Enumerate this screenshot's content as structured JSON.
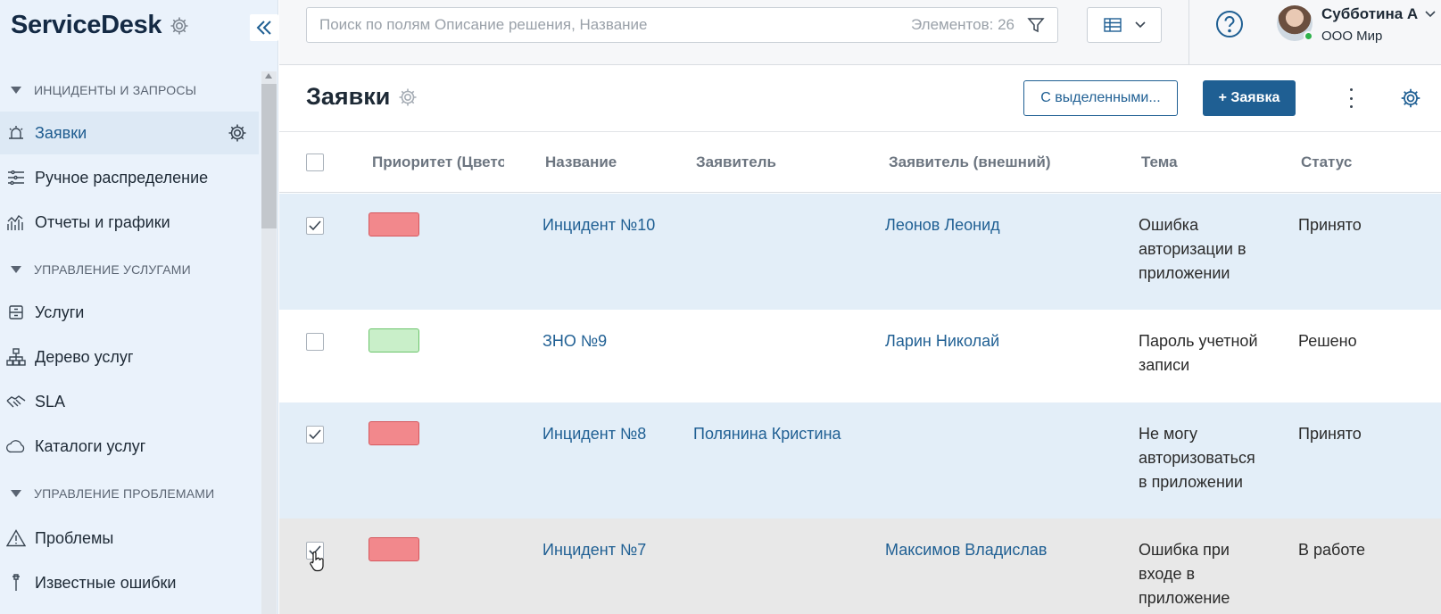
{
  "app": {
    "logo": "ServiceDesk"
  },
  "sidebar": {
    "sections": [
      {
        "title": "ИНЦИДЕНТЫ И ЗАПРОСЫ"
      },
      {
        "title": "УПРАВЛЕНИЕ УСЛУГАМИ"
      },
      {
        "title": "УПРАВЛЕНИЕ ПРОБЛЕМАМИ"
      }
    ],
    "items": [
      {
        "label": "Заявки",
        "icon": "requests-icon"
      },
      {
        "label": "Ручное распределение",
        "icon": "distribution-icon"
      },
      {
        "label": "Отчеты и графики",
        "icon": "chart-icon"
      },
      {
        "label": "Услуги",
        "icon": "services-icon"
      },
      {
        "label": "Дерево услуг",
        "icon": "tree-icon"
      },
      {
        "label": "SLA",
        "icon": "handshake-icon"
      },
      {
        "label": "Каталоги услуг",
        "icon": "cloud-icon"
      },
      {
        "label": "Проблемы",
        "icon": "warning-icon"
      },
      {
        "label": "Известные ошибки",
        "icon": "tool-icon"
      }
    ]
  },
  "topbar": {
    "search_placeholder": "Поиск по полям Описание решения, Название",
    "element_count": "Элементов: 26",
    "user_name": "Субботина А",
    "user_org": "ООО Мир"
  },
  "header": {
    "title": "Заявки",
    "selected_button": "С выделенными...",
    "new_button": "+ Заявка"
  },
  "table": {
    "columns": [
      "Приоритет (Цвето",
      "Название",
      "Заявитель",
      "Заявитель (внешний)",
      "Тема",
      "Статус"
    ],
    "rows": [
      {
        "checked": true,
        "priority": "high",
        "name": "Инцидент №10",
        "applicant": "",
        "external": "Леонов Леонид",
        "topic": [
          "Ошибка",
          "авторизации в",
          "приложении"
        ],
        "status": "Принято"
      },
      {
        "checked": false,
        "priority": "low",
        "name": "ЗНО №9",
        "applicant": "",
        "external": "Ларин Николай",
        "topic": [
          "Пароль учетной",
          "записи"
        ],
        "status": "Решено"
      },
      {
        "checked": true,
        "priority": "high",
        "name": "Инцидент №8",
        "applicant": "Полянина Кристина",
        "external": "",
        "topic": [
          "Не могу",
          "авторизоваться",
          "в приложении"
        ],
        "status": "Принято"
      },
      {
        "checked": true,
        "priority": "high",
        "name": "Инцидент №7",
        "applicant": "",
        "external": "Максимов Владислав",
        "topic": [
          "Ошибка при",
          "входе в",
          "приложение"
        ],
        "status": "В работе"
      }
    ]
  },
  "colors": {
    "accent": "#1f5f93",
    "sidebar_bg": "#eaf2fb",
    "selected_row": "#e3eef8",
    "priority_high": "#f2888c",
    "priority_low": "#c9efc9"
  }
}
